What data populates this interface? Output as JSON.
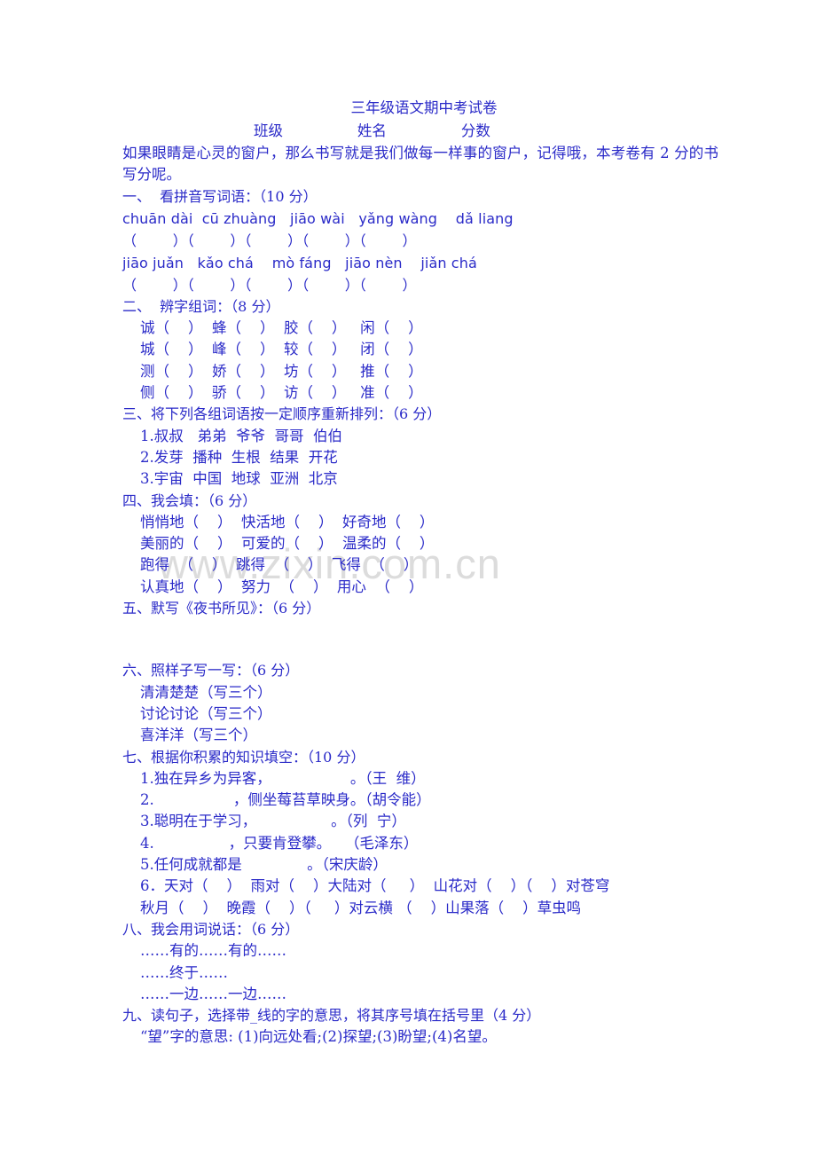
{
  "document": {
    "title": "三年级语文期中考试卷",
    "header_fields": "班级                姓名                分数",
    "intro": "如果眼睛是心灵的窗户，那么书写就是我们做每一样事的窗户，记得哦，本考卷有 2 分的书写分呢。",
    "watermark": "www.zixin.com.cn",
    "text_color": "#2a2ac8",
    "watermark_color": "#dcdcdc"
  },
  "sections": {
    "s1": {
      "heading": "一、  看拼音写词语：（10 分）",
      "pinyin_row1": "chuān dài  cū zhuàng   jiāo wài   yǎng wàng    dǎ liang",
      "brackets_row1": "（        ）（        ）（        ）（        ）（        ）",
      "pinyin_row2": "jiāo juǎn   kǎo chá    mò fáng   jiāo nèn    jiǎn chá",
      "brackets_row2": "（        ）（        ）（        ）（        ）（        ）"
    },
    "s2": {
      "heading": "二、  辨字组词：（8 分）",
      "row1": "诚（    ）  蜂（    ）  胶（    ）   闲（    ）",
      "row2": "城（    ）  峰（    ）  较（    ）   闭（    ）",
      "row3": "测（    ）  娇（    ）  坊（    ）   推（    ）",
      "row4": "侧（    ）  骄（    ）  访（    ）   准（    ）"
    },
    "s3": {
      "heading": "三、将下列各组词语按一定顺序重新排列：（6 分）",
      "item1": "1.叔叔   弟弟  爷爷  哥哥  伯伯",
      "item2": "2.发芽  播种  生根  结果  开花",
      "item3": "3.宇宙  中国  地球  亚洲  北京"
    },
    "s4": {
      "heading": "四、我会填：（6 分）",
      "row1": "悄悄地（    ）  快活地（    ）  好奇地（    ）",
      "row2": "美丽的（    ）  可爱的（    ）  温柔的（    ）",
      "row3": "跑得  （    ）  跳得  （    ）  飞得  （    ）",
      "row4": "认真地（    ）  努力  （    ）  用心  （    ）"
    },
    "s5": {
      "heading": "五、默写《夜书所见》：（6 分）"
    },
    "s6": {
      "heading": "六、照样子写一写：（6 分）",
      "item1": "清清楚楚（写三个）",
      "item2": "讨论讨论（写三个）",
      "item3": "喜洋洋（写三个）"
    },
    "s7": {
      "heading": "七、根据你积累的知识填空：（10 分）",
      "item1": "1.独在异乡为异客，                 。（王  维）",
      "item2": "2.                 ，侧坐莓苔草映身。（胡令能）",
      "item3": "3.聪明在于学习，                。（列  宁）",
      "item4": "4.                ，只要肯登攀。   （毛泽东）",
      "item5": "5.任何成就都是              。（宋庆龄）",
      "item6_line1": "6．天对（    ）  雨对（    ）大陆对（     ）  山花对（    ）（    ）对苍穹",
      "item6_line2": "秋月（    ）  晚霞（    ）（     ）对云横 （    ）山果落（    ）草虫鸣"
    },
    "s8": {
      "heading": "八、我会用词说话：（6 分）",
      "item1": "……有的……有的……",
      "item2": "……终于……",
      "item3": "……一边……一边……"
    },
    "s9": {
      "heading": "九、读句子，选择带_线的字的意思，将其序号填在括号里（4 分）",
      "item1": "“望”字的意思: (1)向远处看;(2)探望;(3)盼望;(4)名望。"
    }
  }
}
